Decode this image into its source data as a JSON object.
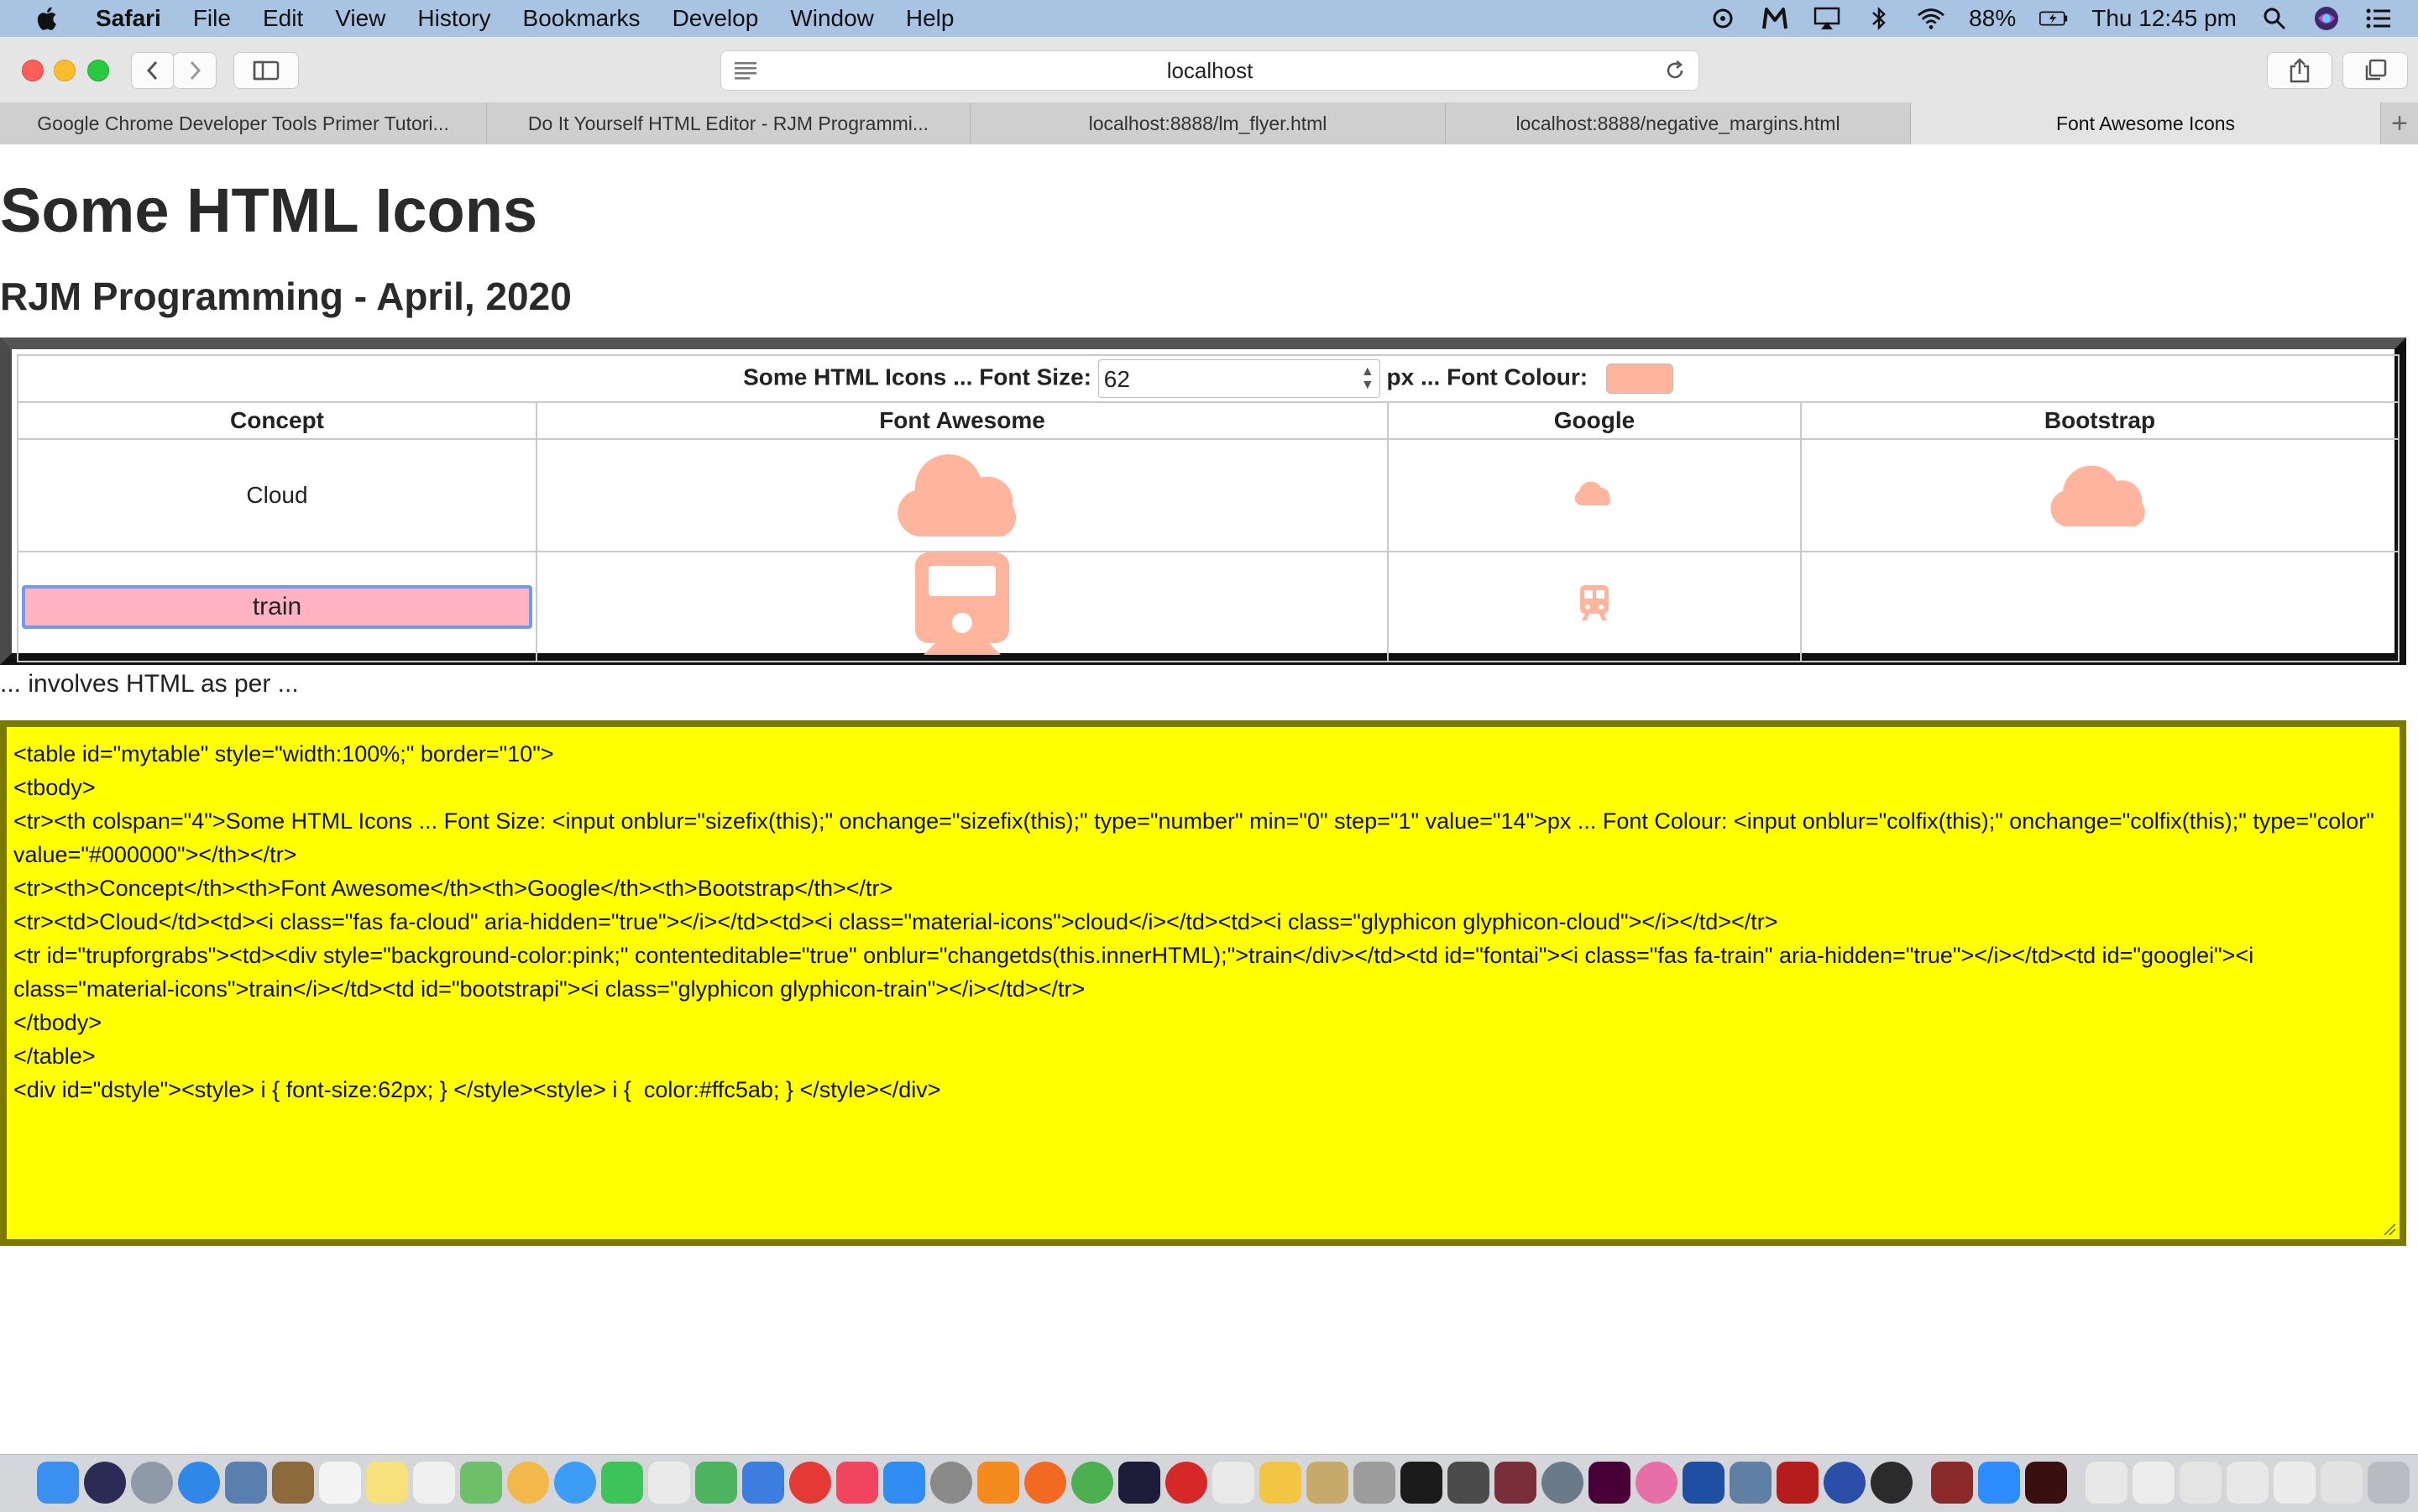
{
  "menubar": {
    "app_name": "Safari",
    "menus": [
      "File",
      "Edit",
      "View",
      "History",
      "Bookmarks",
      "Develop",
      "Window",
      "Help"
    ],
    "battery": "88%",
    "clock": "Thu 12:45 pm"
  },
  "toolbar": {
    "url": "localhost"
  },
  "tabs": [
    "Google Chrome Developer Tools Primer Tutori...",
    "Do It Yourself HTML Editor - RJM Programmi...",
    "localhost:8888/lm_flyer.html",
    "localhost:8888/negative_margins.html",
    "Font Awesome Icons"
  ],
  "page": {
    "title": "Some HTML Icons",
    "subtitle": "RJM Programming - April, 2020",
    "table": {
      "header_prefix": "Some HTML Icons ... Font Size:",
      "font_size_value": "62",
      "header_middle": "px ... Font Colour:",
      "font_colour": "#ffb49d",
      "columns": [
        "Concept",
        "Font Awesome",
        "Google",
        "Bootstrap"
      ],
      "rows": [
        {
          "concept": "Cloud"
        },
        {
          "concept": "train"
        }
      ]
    },
    "involves_text": "... involves HTML as per ...",
    "code_lines": [
      "<table id=\"mytable\" style=\"width:100%;\" border=\"10\">",
      "<tbody>",
      "<tr><th colspan=\"4\">Some HTML Icons ... Font Size: <input onblur=\"sizefix(this);\" onchange=\"sizefix(this);\" type=\"number\" min=\"0\" step=\"1\" value=\"14\">px ... Font Colour: <input onblur=\"colfix(this);\" onchange=\"colfix(this);\" type=\"color\" value=\"#000000\"></th></tr>",
      "<tr><th>Concept</th><th>Font Awesome</th><th>Google</th><th>Bootstrap</th></tr>",
      "<tr><td>Cloud</td><td><i class=\"fas fa-cloud\" aria-hidden=\"true\"></i></td><td><i class=\"material-icons\">cloud</i></td><td><i class=\"glyphicon glyphicon-cloud\"></i></td></tr>",
      "<tr id=\"trupforgrabs\"><td><div style=\"background-color:pink;\" contenteditable=\"true\" onblur=\"changetds(this.innerHTML);\">train</div></td><td id=\"fontai\"><i class=\"fas fa-train\" aria-hidden=\"true\"></i></td><td id=\"googlei\"><i class=\"material-icons\">train</i></td><td id=\"bootstrapi\"><i class=\"glyphicon glyphicon-train\"></i></td></tr>",
      "</tbody>",
      "</table>",
      "<div id=\"dstyle\"><style> i { font-size:62px; } </style><style> i {  color:#ffc5ab; } </style></div>"
    ]
  },
  "colors": {
    "icon": "#ffb49d",
    "code_bg": "#ffff00",
    "pink": "#ffb3c1"
  }
}
